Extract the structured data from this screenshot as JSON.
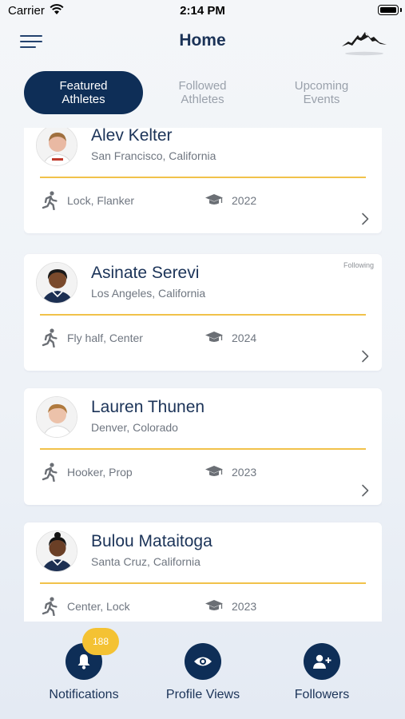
{
  "status_bar": {
    "carrier": "Carrier",
    "time": "2:14 PM"
  },
  "nav": {
    "title": "Home",
    "menu_icon": "hamburger-menu-icon",
    "logo_icon": "mountain-logo-icon"
  },
  "tabs": [
    {
      "label": "Featured\nAthletes",
      "active": true
    },
    {
      "label": "Followed\nAthletes",
      "active": false
    },
    {
      "label": "Upcoming\nEvents",
      "active": false
    }
  ],
  "athletes": [
    {
      "name": "Alev Kelter",
      "location": "San Francisco, California",
      "positions": "Lock, Flanker",
      "year": "2022",
      "following": ""
    },
    {
      "name": "Asinate Serevi",
      "location": "Los Angeles, California",
      "positions": "Fly half, Center",
      "year": "2024",
      "following": "Following"
    },
    {
      "name": "Lauren Thunen",
      "location": "Denver, Colorado",
      "positions": "Hooker, Prop",
      "year": "2023",
      "following": ""
    },
    {
      "name": "Bulou Mataitoga",
      "location": "Santa Cruz, California",
      "positions": "Center, Lock",
      "year": "2023",
      "following": ""
    }
  ],
  "bottom_nav": {
    "notifications": {
      "label": "Notifications",
      "badge": "188",
      "icon": "bell-icon"
    },
    "profile_views": {
      "label": "Profile Views",
      "icon": "eye-icon"
    },
    "followers": {
      "label": "Followers",
      "icon": "add-user-icon"
    }
  },
  "colors": {
    "navy": "#0e2e57",
    "accent_gold": "#f1c24a",
    "badge": "#f4c233",
    "text_gray": "#6f7680"
  }
}
